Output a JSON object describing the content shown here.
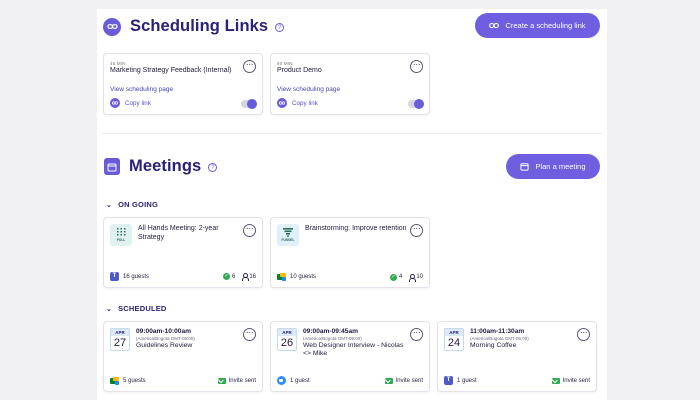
{
  "scheduling": {
    "title": "Scheduling Links",
    "help": "?",
    "create_button": "Create a scheduling link",
    "cards": [
      {
        "duration": "45 MIN",
        "title": "Marketing Strategy Feedback (Internal)",
        "view_link": "View scheduling page",
        "copy_link": "Copy link",
        "enabled": true
      },
      {
        "duration": "60 MIN",
        "title": "Product Demo",
        "view_link": "View scheduling page",
        "copy_link": "Copy link",
        "enabled": true
      }
    ]
  },
  "meetings": {
    "title": "Meetings",
    "help": "?",
    "plan_button": "Plan a meeting",
    "ongoing_label": "ON GOING",
    "ongoing": [
      {
        "app_label": "POLL",
        "title": "All Hands Meeting: 2-year Strategy",
        "guests": "16 guests",
        "accepted": "6",
        "total": "16",
        "platform": "teams-icon"
      },
      {
        "app_label": "FUNNEL",
        "title": "Brainstorming: Improve retention",
        "guests": "10 guests",
        "accepted": "4",
        "total": "10",
        "platform": "google-meet-icon"
      }
    ],
    "scheduled_label": "SCHEDULED",
    "scheduled": [
      {
        "month": "APR",
        "day": "27",
        "time": "09:00am-10:00am",
        "tz": "(America/Bogota GMT-05:00)",
        "title": "Guidelines Review",
        "guests": "5 guests",
        "status": "Invite sent",
        "platform": "google-meet-icon"
      },
      {
        "month": "APR",
        "day": "26",
        "time": "09:00am-09:45am",
        "tz": "(America/Bogota GMT-05:00)",
        "title": "Web Designer Interview - Nicolas <> Mike",
        "guests": "1 guest",
        "status": "Invite sent",
        "platform": "zoom-icon"
      },
      {
        "month": "APR",
        "day": "24",
        "time": "11:00am-11:30am",
        "tz": "(America/Bogota GMT-05:00)",
        "title": "Morning Coffee",
        "guests": "1 guest",
        "status": "Invite sent",
        "platform": "teams-icon"
      }
    ]
  },
  "colors": {
    "accent": "#6d5fe0",
    "heading": "#2a2274",
    "success": "#34a853"
  }
}
